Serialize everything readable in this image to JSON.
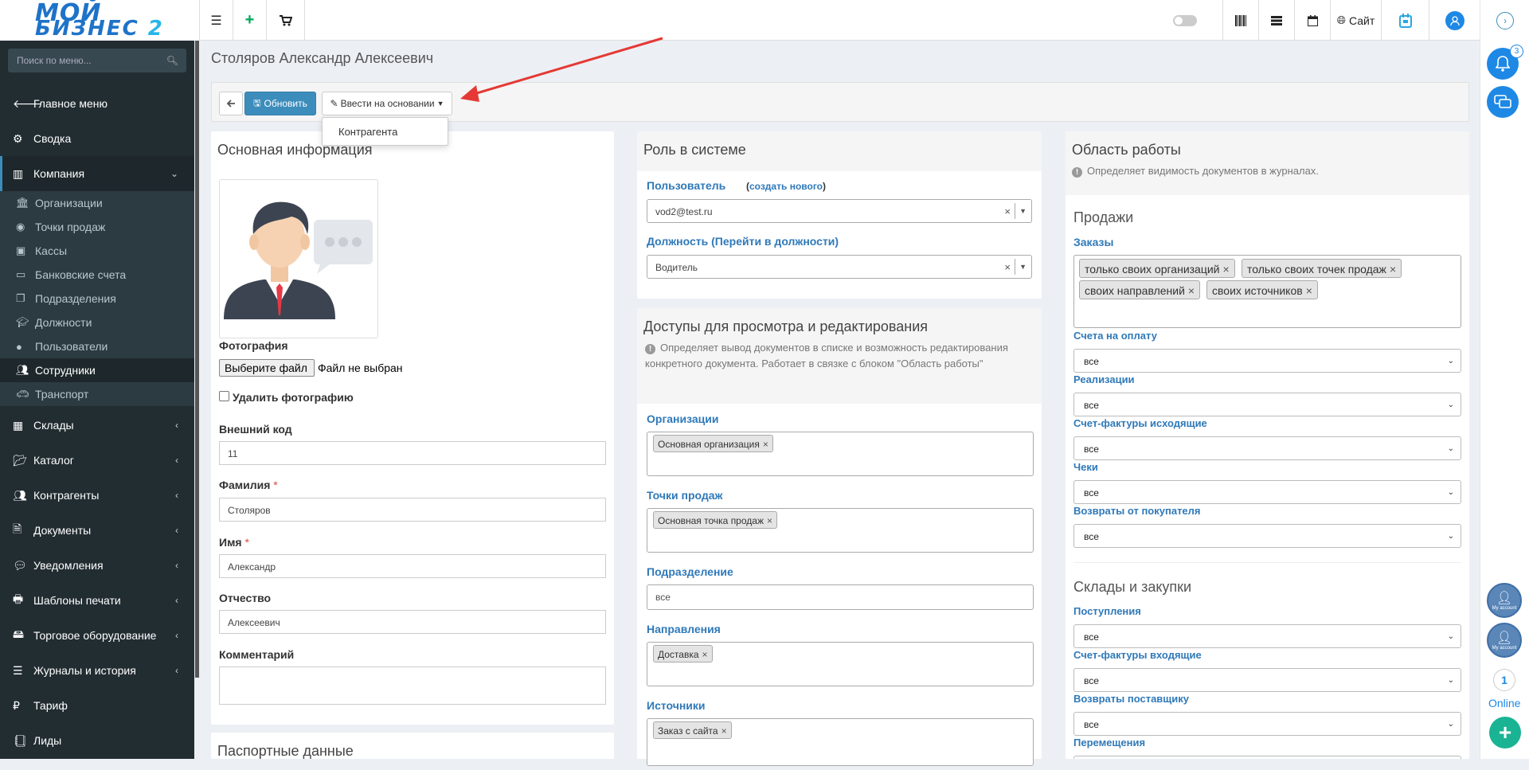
{
  "logo": {
    "line1": "МОЙ",
    "line2a": "БИЗНЕС",
    "line2b": "2"
  },
  "sidebar": {
    "search_placeholder": "Поиск по меню...",
    "items": [
      {
        "label": "Главное меню"
      },
      {
        "label": "Сводка"
      },
      {
        "label": "Компания"
      },
      {
        "label": "Склады"
      },
      {
        "label": "Каталог"
      },
      {
        "label": "Контрагенты"
      },
      {
        "label": "Документы"
      },
      {
        "label": "Уведомления"
      },
      {
        "label": "Шаблоны печати"
      },
      {
        "label": "Торговое оборудование"
      },
      {
        "label": "Журналы и история"
      },
      {
        "label": "Тариф"
      },
      {
        "label": "Лиды"
      }
    ],
    "company_sub": [
      {
        "label": "Организации"
      },
      {
        "label": "Точки продаж"
      },
      {
        "label": "Кассы"
      },
      {
        "label": "Банковские счета"
      },
      {
        "label": "Подразделения"
      },
      {
        "label": "Должности"
      },
      {
        "label": "Пользователи"
      },
      {
        "label": "Сотрудники"
      },
      {
        "label": "Транспорт"
      }
    ]
  },
  "topbar": {
    "site_label": "Сайт"
  },
  "rail": {
    "notif_count": "3",
    "online_count": "1",
    "online_label": "Online",
    "account_label": "My account"
  },
  "page": {
    "title": "Столяров Александр Алексеевич"
  },
  "toolbar": {
    "update_label": "Обновить",
    "based_on_label": "Ввести на основании",
    "dropdown_item": "Контрагента"
  },
  "basic": {
    "header": "Основная информация",
    "photo_label": "Фотография",
    "file_button": "Выберите файл",
    "file_status": "Файл не выбран",
    "delete_photo": "Удалить фотографию",
    "ext_code_label": "Внешний код",
    "ext_code": "11",
    "surname_label": "Фамилия",
    "surname": "Столяров",
    "name_label": "Имя",
    "name": "Александр",
    "patronymic_label": "Отчество",
    "patronymic": "Алексеевич",
    "comment_label": "Комментарий",
    "passport_header": "Паспортные данные"
  },
  "role": {
    "header": "Роль в системе",
    "user_label": "Пользователь",
    "create_new": "(создать нового)",
    "user_value": "vod2@test.ru",
    "position_label": "Должность (Перейти в должности)",
    "position_value": "Водитель"
  },
  "access": {
    "header": "Доступы для просмотра и редактирования",
    "note": "Определяет вывод документов в списке и возможность редактирования конкретного документа. Работает в связке с блоком \"Область работы\"",
    "org_label": "Организации",
    "org_tag": "Основная организация",
    "points_label": "Точки продаж",
    "points_tag": "Основная точка продаж",
    "division_label": "Подразделение",
    "division_value": "все",
    "directions_label": "Направления",
    "directions_tag": "Доставка",
    "sources_label": "Источники",
    "sources_tag": "Заказ с сайта"
  },
  "area": {
    "header": "Область работы",
    "note": "Определяет видимость документов в журналах.",
    "sales_header": "Продажи",
    "orders_label": "Заказы",
    "orders_tags": [
      "только своих организаций",
      "только своих точек продаж",
      "своих направлений",
      "своих источников"
    ],
    "invoices_label": "Счета на оплату",
    "invoices_value": "все",
    "realizations_label": "Реализации",
    "realizations_value": "все",
    "sf_out_label": "Счет-фактуры исходящие",
    "sf_out_value": "все",
    "checks_label": "Чеки",
    "checks_value": "все",
    "returns_buyer_label": "Возвраты от покупателя",
    "returns_buyer_value": "все",
    "warehouse_header": "Склады и закупки",
    "receipts_label": "Поступления",
    "receipts_value": "все",
    "sf_in_label": "Счет-фактуры входящие",
    "sf_in_value": "все",
    "returns_supplier_label": "Возвраты поставщику",
    "returns_supplier_value": "все",
    "moves_label": "Перемещения"
  },
  "colors": {
    "accent": "#3c8dbc",
    "sidebar": "#222d32",
    "label_blue": "#2f79b9",
    "arrow": "#e53935"
  }
}
